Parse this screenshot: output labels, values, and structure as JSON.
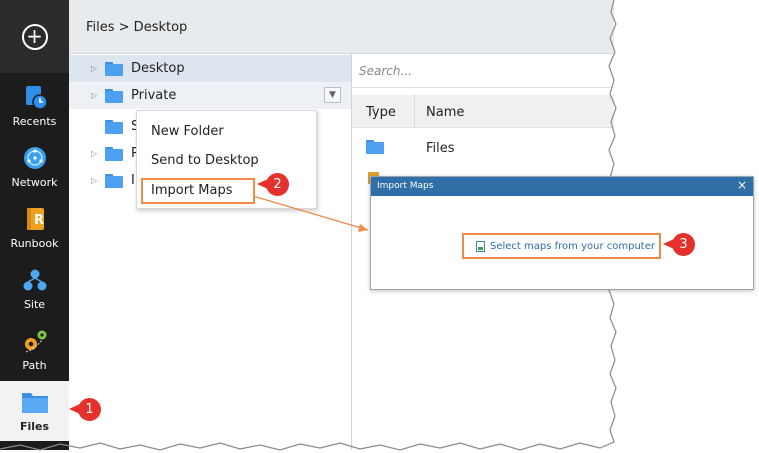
{
  "nav": {
    "add_icon": "plus-circle-icon",
    "items": [
      {
        "label": "Recents",
        "icon": "recents-icon"
      },
      {
        "label": "Network",
        "icon": "network-icon"
      },
      {
        "label": "Runbook",
        "icon": "runbook-icon"
      },
      {
        "label": "Site",
        "icon": "site-icon"
      },
      {
        "label": "Path",
        "icon": "path-icon"
      },
      {
        "label": "Files",
        "icon": "files-icon"
      }
    ]
  },
  "header": {
    "breadcrumb": "Files > Desktop"
  },
  "tree": {
    "rows": [
      {
        "label": "Desktop"
      },
      {
        "label": "Private"
      },
      {
        "label": "S"
      },
      {
        "label": "P"
      },
      {
        "label": "I"
      }
    ],
    "dropdown_icon": "chevron-down-icon"
  },
  "context_menu": {
    "items": [
      "New Folder",
      "Send to Desktop",
      "Import Maps"
    ]
  },
  "list": {
    "search_placeholder": "Search...",
    "columns": [
      "Type",
      "Name"
    ],
    "rows": [
      {
        "name": "Files"
      }
    ]
  },
  "dialog": {
    "title": "Import Maps",
    "close": "×",
    "link": "Select maps from your computer"
  },
  "callouts": [
    "1",
    "2",
    "3"
  ],
  "colors": {
    "accent": "#2f6ea6",
    "highlight": "#f08a4b",
    "callout": "#e4312b",
    "folder": "#4d9ff0",
    "nav_bg": "#1c1c1c"
  }
}
